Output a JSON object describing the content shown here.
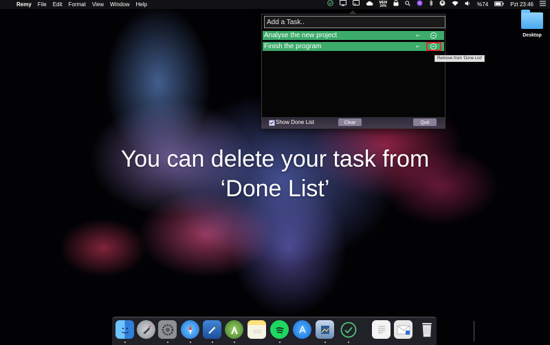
{
  "menubar": {
    "apple": "",
    "app_name": "Remy",
    "menus": [
      "File",
      "Edit",
      "Format",
      "View",
      "Window",
      "Help"
    ],
    "status": {
      "cpu_top": "MEM",
      "cpu_bottom": "24%",
      "battery": "%74",
      "clock": "Pzt 23:46"
    }
  },
  "desktop": {
    "folder_label": "Desktop"
  },
  "popover": {
    "input_placeholder": "Add a Task..",
    "tasks": [
      {
        "label": "Analyse the new project"
      },
      {
        "label": "Finish the program"
      }
    ],
    "show_done_label": "Show Done List",
    "clear_label": "Clear",
    "quit_label": "Quit"
  },
  "tooltip": "Remove from 'Done List'",
  "caption": {
    "line1": "You can delete your task from",
    "line2": "‘Done List’"
  },
  "colors": {
    "task_row": "#3dab6a",
    "highlight": "#d83030",
    "footer": "#423b4c"
  },
  "dock": {
    "apps": [
      {
        "name": "finder-icon"
      },
      {
        "name": "launchpad-icon"
      },
      {
        "name": "system-preferences-icon"
      },
      {
        "name": "safari-icon"
      },
      {
        "name": "xcode-icon"
      },
      {
        "name": "android-studio-icon"
      },
      {
        "name": "notes-icon"
      },
      {
        "name": "spotify-icon"
      },
      {
        "name": "app-store-icon"
      },
      {
        "name": "preview-icon"
      },
      {
        "name": "remy-check-icon"
      },
      {
        "name": "document-icon"
      },
      {
        "name": "mail-doc-icon"
      },
      {
        "name": "trash-icon"
      }
    ]
  }
}
